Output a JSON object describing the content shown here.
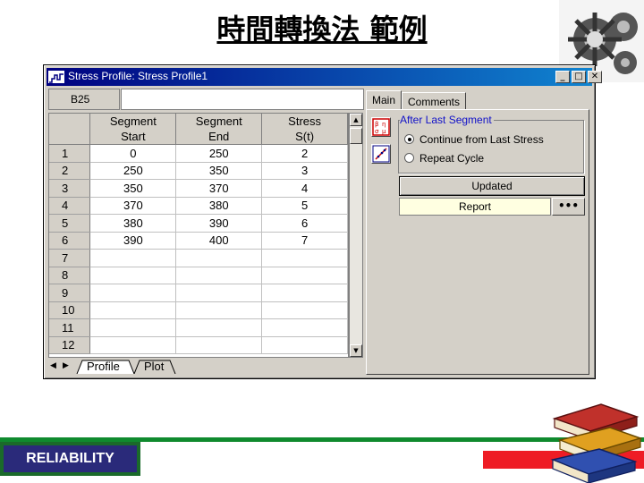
{
  "slide": {
    "title": "時間轉換法 範例",
    "badge": "RELIABILITY"
  },
  "window": {
    "title": "Stress Profile: Stress Profile1",
    "buttons": {
      "minimize": "_",
      "maximize": "□",
      "close": "✕"
    }
  },
  "sheet": {
    "cell_ref": "B25",
    "formula_value": "",
    "columns": [
      {
        "line1": "Segment",
        "line2": "Start"
      },
      {
        "line1": "Segment",
        "line2": "End"
      },
      {
        "line1": "Stress",
        "line2": "S(t)"
      }
    ],
    "row_numbers": [
      "1",
      "2",
      "3",
      "4",
      "5",
      "6",
      "7",
      "8",
      "9",
      "10",
      "11",
      "12"
    ],
    "rows": [
      [
        "0",
        "250",
        "2"
      ],
      [
        "250",
        "350",
        "3"
      ],
      [
        "350",
        "370",
        "4"
      ],
      [
        "370",
        "380",
        "5"
      ],
      [
        "380",
        "390",
        "6"
      ],
      [
        "390",
        "400",
        "7"
      ],
      [
        "",
        "",
        ""
      ],
      [
        "",
        "",
        ""
      ],
      [
        "",
        "",
        ""
      ],
      [
        "",
        "",
        ""
      ],
      [
        "",
        "",
        ""
      ],
      [
        "",
        "",
        ""
      ]
    ],
    "tabs": [
      "Profile",
      "Plot"
    ],
    "active_tab": "Profile"
  },
  "panel": {
    "tabs": [
      "Main",
      "Comments"
    ],
    "active_tab": "Main",
    "group_label": "After Last Segment",
    "options": [
      {
        "label": "Continue from Last Stress",
        "selected": true
      },
      {
        "label": "Repeat Cycle",
        "selected": false
      }
    ],
    "updated_label": "Updated",
    "report_label": "Report",
    "more_label": "•••"
  },
  "colors": {
    "titlebar": "#000080",
    "accent_green": "#0f8a2e",
    "accent_red": "#ee1c25",
    "badge_bg": "#2a2a7a",
    "legend_text": "#1010c8"
  }
}
